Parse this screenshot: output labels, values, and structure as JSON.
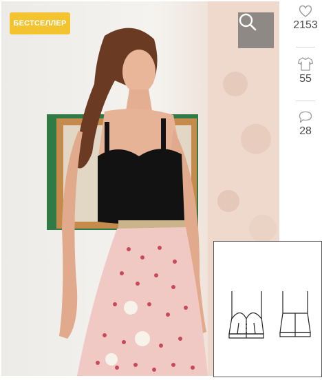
{
  "badge": {
    "label": "БЕСТСЕЛЛЕР"
  },
  "stats": {
    "likes": {
      "icon": "heart-icon",
      "value": "2153"
    },
    "made": {
      "icon": "tshirt-icon",
      "value": "55"
    },
    "comments": {
      "icon": "comment-icon",
      "value": "28"
    }
  },
  "colors": {
    "badge": "#f4c430",
    "stat_text": "#4d4d4d",
    "icon": "#9a9a9a",
    "search_overlay": "#6e6e6e"
  },
  "images": {
    "main": "model-in-black-bustier-and-pink-skirt-photo",
    "sketch": "bustier-technical-drawing"
  }
}
